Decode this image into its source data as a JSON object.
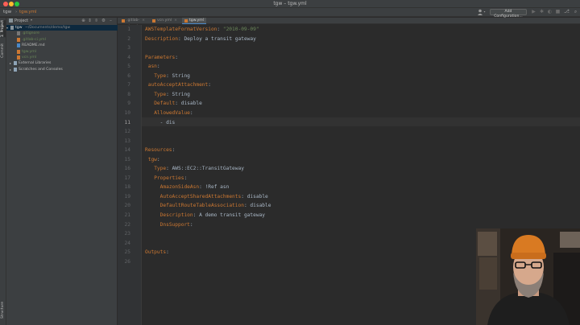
{
  "window": {
    "title": "tgw – tgw.yml"
  },
  "nav": {
    "crumbs": [
      "tgw",
      "tgw.yml"
    ],
    "run_config_label": "Add Configuration..."
  },
  "toolstrip": {
    "project_tab": "1: Project",
    "commit_tab": "Commit",
    "structure_tab": "Structure"
  },
  "project_panel": {
    "title": "Project",
    "tree": [
      {
        "label": "tgw",
        "path": "~/Documents/demo/tgw",
        "indent": 0,
        "arrow": "▾",
        "selected": true,
        "icon_color": "#87939a",
        "label_color": "#d0d0d0"
      },
      {
        "label": ".gitignore",
        "indent": 2,
        "icon_color": "#787878",
        "label_color": "#6a8759"
      },
      {
        "label": ".gitlab-ci.yml",
        "indent": 2,
        "icon_color": "#cc7832",
        "label_color": "#6a8759"
      },
      {
        "label": "README.md",
        "indent": 2,
        "icon_color": "#4a88c7",
        "label_color": "#bbbbbb"
      },
      {
        "label": "tgw.yml",
        "indent": 2,
        "icon_color": "#cc7832",
        "label_color": "#6a8759"
      },
      {
        "label": "vcn.yml",
        "indent": 2,
        "icon_color": "#cc7832",
        "label_color": "#6a8759"
      },
      {
        "label": "External Libraries",
        "indent": 1,
        "arrow": "▸",
        "icon_color": "#8ea4b7",
        "label_color": "#bbbbbb"
      },
      {
        "label": "Scratches and Consoles",
        "indent": 1,
        "arrow": "▸",
        "icon_color": "#8ea4b7",
        "label_color": "#bbbbbb"
      }
    ]
  },
  "tabs": [
    {
      "label": ".gitlab-ci.yml",
      "active": false
    },
    {
      "label": "vcn.yml",
      "active": false
    },
    {
      "label": "tgw.yml",
      "active": true
    }
  ],
  "editor": {
    "current_line": 11,
    "lines": [
      {
        "n": "1",
        "key": "AWSTemplateFormatVersion",
        "sep": ": ",
        "val": "\"2010-09-09\"",
        "indent": "",
        "val_type": "s"
      },
      {
        "n": "2",
        "key": "Description",
        "sep": ": ",
        "val": "Deploy a transit gateway",
        "indent": "",
        "val_type": "v"
      },
      {
        "n": "3",
        "key": "",
        "sep": "",
        "val": "",
        "indent": "",
        "val_type": "v"
      },
      {
        "n": "4",
        "key": "Parameters",
        "sep": ":",
        "val": "",
        "indent": "",
        "val_type": "v"
      },
      {
        "n": "5",
        "key": "asn",
        "sep": ":",
        "val": "",
        "indent": " ",
        "val_type": "v"
      },
      {
        "n": "6",
        "key": "Type",
        "sep": ": ",
        "val": "String",
        "indent": "   ",
        "val_type": "v"
      },
      {
        "n": "7",
        "key": "autoAcceptAttachment",
        "sep": ":",
        "val": "",
        "indent": " ",
        "val_type": "v"
      },
      {
        "n": "8",
        "key": "Type",
        "sep": ": ",
        "val": "String",
        "indent": "   ",
        "val_type": "v"
      },
      {
        "n": "9",
        "key": "Default",
        "sep": ": ",
        "val": "disable",
        "indent": "   ",
        "val_type": "v"
      },
      {
        "n": "10",
        "key": "AllowedValue",
        "sep": ":",
        "val": "",
        "indent": "   ",
        "val_type": "v"
      },
      {
        "n": "11",
        "key": "",
        "sep": "",
        "val": "- dis",
        "indent": "     ",
        "val_type": "v"
      },
      {
        "n": "12",
        "key": "",
        "sep": "",
        "val": "",
        "indent": "",
        "val_type": "v"
      },
      {
        "n": "13",
        "key": "",
        "sep": "",
        "val": "",
        "indent": "",
        "val_type": "v"
      },
      {
        "n": "14",
        "key": "Resources",
        "sep": ":",
        "val": "",
        "indent": "",
        "val_type": "v"
      },
      {
        "n": "15",
        "key": "tgw",
        "sep": ":",
        "val": "",
        "indent": " ",
        "val_type": "v"
      },
      {
        "n": "16",
        "key": "Type",
        "sep": ": ",
        "val": "AWS::EC2::TransitGateway",
        "indent": "   ",
        "val_type": "v"
      },
      {
        "n": "17",
        "key": "Properties",
        "sep": ":",
        "val": "",
        "indent": "   ",
        "val_type": "v"
      },
      {
        "n": "18",
        "key": "AmazonSideAsn",
        "sep": ": ",
        "val": "!Ref asn",
        "indent": "     ",
        "val_type": "v"
      },
      {
        "n": "19",
        "key": "AutoAcceptSharedAttachments",
        "sep": ": ",
        "val": "disable",
        "indent": "     ",
        "val_type": "v"
      },
      {
        "n": "20",
        "key": "DefaultRouteTableAssociation",
        "sep": ": ",
        "val": "disable",
        "indent": "     ",
        "val_type": "v"
      },
      {
        "n": "21",
        "key": "Description",
        "sep": ": ",
        "val": "A demo transit gateway",
        "indent": "     ",
        "val_type": "v"
      },
      {
        "n": "22",
        "key": "DnsSupport",
        "sep": ":",
        "val": "",
        "indent": "     ",
        "val_type": "v"
      },
      {
        "n": "23",
        "key": "",
        "sep": "",
        "val": "",
        "indent": "",
        "val_type": "v"
      },
      {
        "n": "24",
        "key": "",
        "sep": "",
        "val": "",
        "indent": "",
        "val_type": "v"
      },
      {
        "n": "25",
        "key": "Outputs",
        "sep": ":",
        "val": "",
        "indent": "",
        "val_type": "v"
      },
      {
        "n": "26",
        "key": "",
        "sep": "",
        "val": "",
        "indent": "",
        "val_type": "v"
      }
    ]
  },
  "webcam": {
    "icon": "person-webcam-overlay"
  },
  "colors": {
    "keyword": "#cc7832",
    "string": "#6a8759",
    "text": "#a9b7c6",
    "selection": "#0d293e",
    "tab_underline": "#4a88c7"
  }
}
